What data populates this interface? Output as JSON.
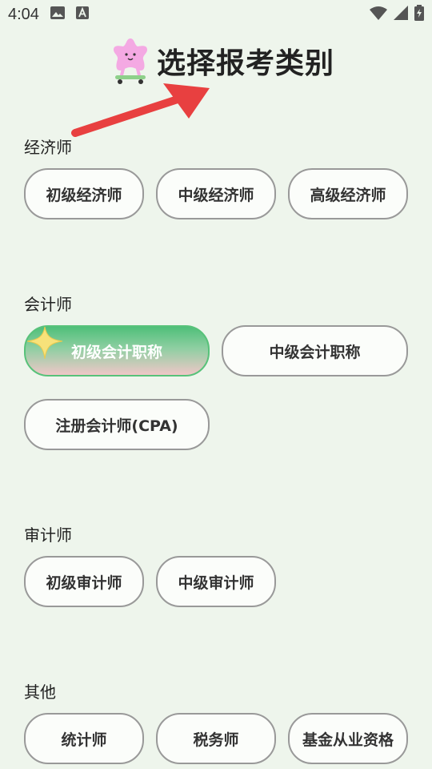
{
  "status_bar": {
    "time": "4:04"
  },
  "header": {
    "title": "选择报考类别"
  },
  "sections": [
    {
      "title": "经济师",
      "items": [
        "初级经济师",
        "中级经济师",
        "高级经济师"
      ]
    },
    {
      "title": "会计师",
      "items": [
        "初级会计职称",
        "中级会计职称",
        "注册会计师(CPA)"
      ],
      "selected_index": 0
    },
    {
      "title": "审计师",
      "items": [
        "初级审计师",
        "中级审计师"
      ]
    },
    {
      "title": "其他",
      "items": [
        "统计师",
        "税务师",
        "基金从业资格"
      ]
    }
  ],
  "colors": {
    "background": "#eef5ec",
    "selected": "#58c27a",
    "arrow": "#e84040"
  }
}
